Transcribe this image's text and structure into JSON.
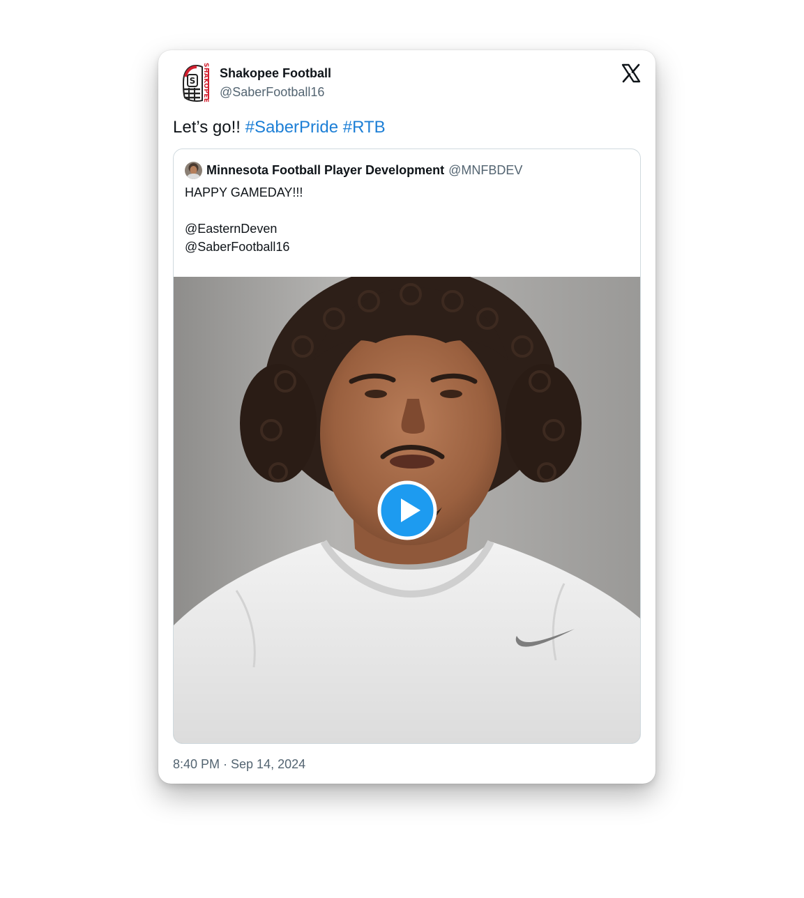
{
  "tweet": {
    "author": {
      "display_name": "Shakopee Football",
      "handle": "@SaberFootball16",
      "avatar_icon": "shakopee-helmet-logo-icon",
      "avatar_text": "SHAKOPEE"
    },
    "platform_icon": "x-logo-icon",
    "text": {
      "prefix": "Let’s go!! ",
      "hashtags": [
        "#SaberPride",
        "#RTB"
      ]
    },
    "quote": {
      "display_name": "Minnesota Football Player Development",
      "handle": "@MNFBDEV",
      "avatar_icon": "profile-photo-icon",
      "lines": [
        "HAPPY GAMEDAY!!!",
        "",
        "@EasternDeven",
        "@SaberFootball16"
      ],
      "media": {
        "type": "video",
        "icon": "play-icon",
        "accent_color": "#1d9bf0"
      }
    },
    "timestamp": "8:40 PM · Sep 14, 2024"
  },
  "colors": {
    "hashtag": "#1d7fd6",
    "text_primary": "#0f1419",
    "text_secondary": "#536471",
    "border": "#cfd9de"
  }
}
